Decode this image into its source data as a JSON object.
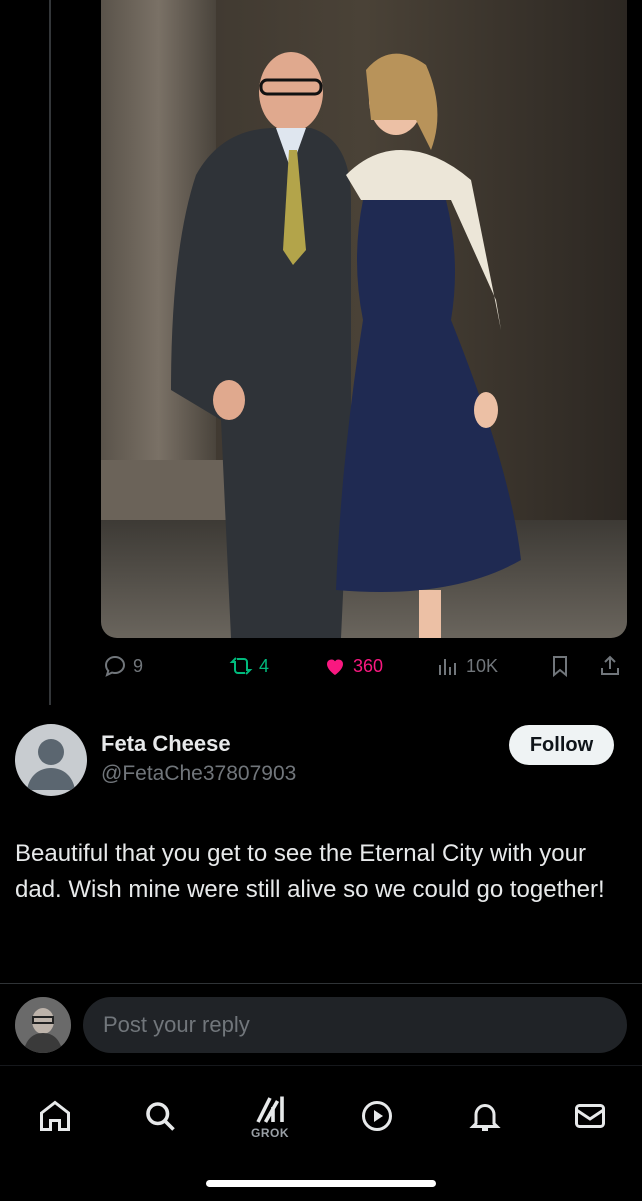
{
  "post": {
    "photo_alt_icon": "photo-image",
    "actions": {
      "replies": "9",
      "reposts": "4",
      "likes": "360",
      "views": "10K"
    }
  },
  "reply": {
    "author_name": "Feta Cheese",
    "author_handle": "@FetaChe37807903",
    "follow_label": "Follow",
    "text": "Beautiful that you get to see the Eternal City with your dad. Wish mine were still alive so we could go together!"
  },
  "compose": {
    "placeholder": "Post your reply"
  },
  "nav": {
    "grok_label": "GROK"
  },
  "colors": {
    "background": "#000000",
    "repost_active": "#00ba7c",
    "like_active": "#f91880",
    "muted": "#71767b",
    "follow_bg": "#eff3f4"
  }
}
